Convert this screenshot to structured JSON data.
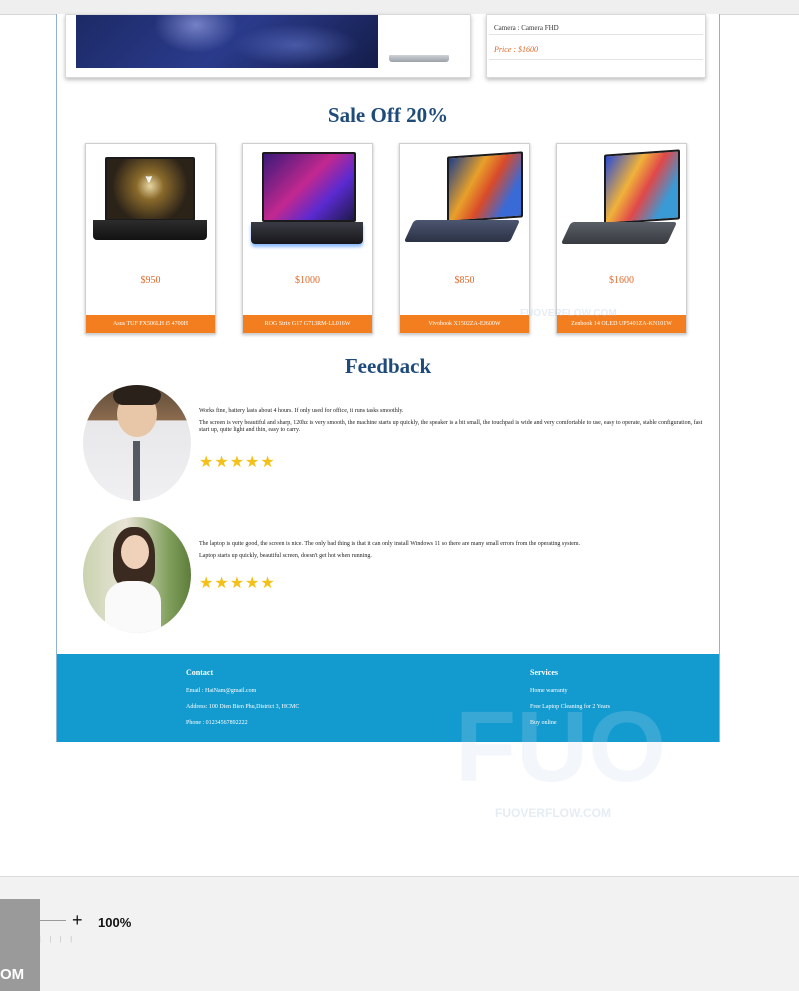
{
  "hero": {
    "camera": "Camera : Camera FHD",
    "price": "Price : $1600"
  },
  "sale": {
    "title": "Sale Off 20%",
    "products": [
      {
        "price": "$950",
        "name": "Asus TUF FX506LH i5 4700H"
      },
      {
        "price": "$1000",
        "name": "ROG Strix G17 G713RM-LL016W"
      },
      {
        "price": "$850",
        "name": "Vivobook X1502ZA-EJ600W"
      },
      {
        "price": "$1600",
        "name": "Zenbook 14 OLED UP5401ZA-KN101W"
      }
    ]
  },
  "feedback": {
    "title": "Feedback",
    "items": [
      {
        "lines": [
          "Works fine, battery lasts about 4 hours. If only used for office, it runs tasks smoothly.",
          "The screen is very beautiful and sharp, 120hz is very smooth, the machine starts up quickly, the speaker is a bit small, the touchpad is wide and very comfortable to use, easy to operate, stable configuration, fast start up, quite light and thin, easy to carry."
        ],
        "stars": "★★★★★"
      },
      {
        "lines": [
          "The laptop is quite good, the screen is nice. The only bad thing is that it can only install Windows 11 so there are many small errors from the operating system.",
          "Laptop starts up quickly, beautiful screen, doesn't get hot when running."
        ],
        "stars": "★★★★★"
      }
    ]
  },
  "footer": {
    "contact": {
      "heading": "Contact",
      "email": "Email : HaiNam@gmail.com",
      "address": "Address: 100 Dien Bien Phu,District 3, HCMC",
      "phone": "Phone : 01234567892222"
    },
    "services": {
      "heading": "Services",
      "items": [
        "Home warranty",
        "Free Laptop Cleaning for 2 Years",
        "Buy online"
      ]
    }
  },
  "watermark": {
    "text": "FUOVERFLOW.COM",
    "logo": "FUO",
    "tail": "OM"
  },
  "viewer": {
    "zoom_in": "+",
    "zoom": "100%"
  }
}
